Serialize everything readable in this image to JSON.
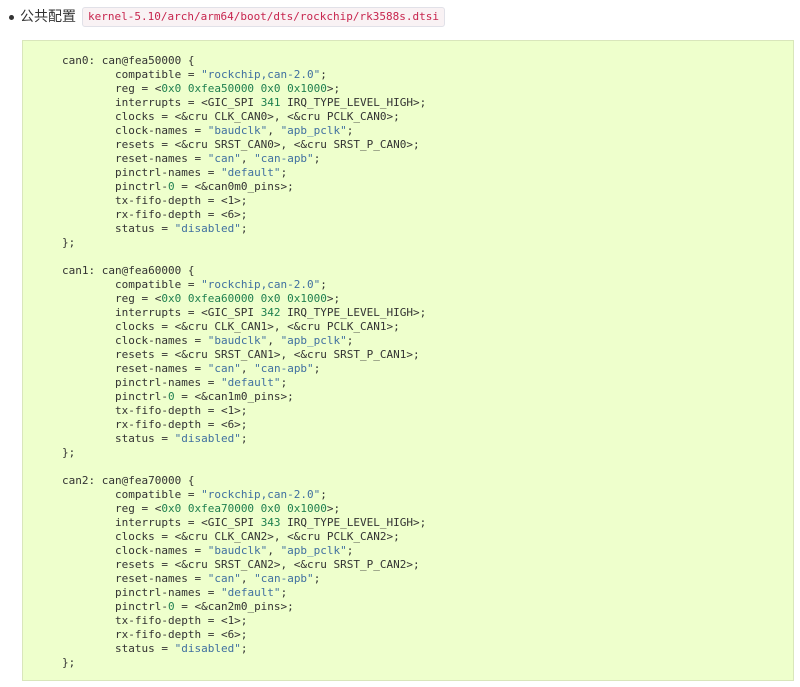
{
  "header": {
    "label": "公共配置",
    "path": "kernel-5.10/arch/arm64/boot/dts/rockchip/rk3588s.dtsi"
  },
  "code": {
    "lines": [
      [
        {
          "t": "can0: can@fea50000 {"
        }
      ],
      [
        {
          "t": "        compatible = "
        },
        {
          "t": "\"rockchip,can-2.0\"",
          "c": "str"
        },
        {
          "t": ";"
        }
      ],
      [
        {
          "t": "        reg = <"
        },
        {
          "t": "0x0 0xfea50000 0x0 0x1000",
          "c": "num"
        },
        {
          "t": ">;"
        }
      ],
      [
        {
          "t": "        interrupts = <GIC_SPI "
        },
        {
          "t": "341",
          "c": "num"
        },
        {
          "t": " IRQ_TYPE_LEVEL_HIGH>;"
        }
      ],
      [
        {
          "t": "        clocks = <&cru CLK_CAN0>, <&cru PCLK_CAN0>;"
        }
      ],
      [
        {
          "t": "        clock-names = "
        },
        {
          "t": "\"baudclk\"",
          "c": "str"
        },
        {
          "t": ", "
        },
        {
          "t": "\"apb_pclk\"",
          "c": "str"
        },
        {
          "t": ";"
        }
      ],
      [
        {
          "t": "        resets = <&cru SRST_CAN0>, <&cru SRST_P_CAN0>;"
        }
      ],
      [
        {
          "t": "        reset-names = "
        },
        {
          "t": "\"can\"",
          "c": "str"
        },
        {
          "t": ", "
        },
        {
          "t": "\"can-apb\"",
          "c": "str"
        },
        {
          "t": ";"
        }
      ],
      [
        {
          "t": "        pinctrl-names = "
        },
        {
          "t": "\"default\"",
          "c": "str"
        },
        {
          "t": ";"
        }
      ],
      [
        {
          "t": "        pinctrl-"
        },
        {
          "t": "0",
          "c": "num"
        },
        {
          "t": " = <&can0m0_pins>;"
        }
      ],
      [
        {
          "t": "        tx-fifo-depth = <1>;"
        }
      ],
      [
        {
          "t": "        rx-fifo-depth = <6>;"
        }
      ],
      [
        {
          "t": "        status = "
        },
        {
          "t": "\"disabled\"",
          "c": "str"
        },
        {
          "t": ";"
        }
      ],
      [
        {
          "t": "};"
        }
      ],
      [
        {
          "t": ""
        }
      ],
      [
        {
          "t": "can1: can@fea60000 {"
        }
      ],
      [
        {
          "t": "        compatible = "
        },
        {
          "t": "\"rockchip,can-2.0\"",
          "c": "str"
        },
        {
          "t": ";"
        }
      ],
      [
        {
          "t": "        reg = <"
        },
        {
          "t": "0x0 0xfea60000 0x0 0x1000",
          "c": "num"
        },
        {
          "t": ">;"
        }
      ],
      [
        {
          "t": "        interrupts = <GIC_SPI "
        },
        {
          "t": "342",
          "c": "num"
        },
        {
          "t": " IRQ_TYPE_LEVEL_HIGH>;"
        }
      ],
      [
        {
          "t": "        clocks = <&cru CLK_CAN1>, <&cru PCLK_CAN1>;"
        }
      ],
      [
        {
          "t": "        clock-names = "
        },
        {
          "t": "\"baudclk\"",
          "c": "str"
        },
        {
          "t": ", "
        },
        {
          "t": "\"apb_pclk\"",
          "c": "str"
        },
        {
          "t": ";"
        }
      ],
      [
        {
          "t": "        resets = <&cru SRST_CAN1>, <&cru SRST_P_CAN1>;"
        }
      ],
      [
        {
          "t": "        reset-names = "
        },
        {
          "t": "\"can\"",
          "c": "str"
        },
        {
          "t": ", "
        },
        {
          "t": "\"can-apb\"",
          "c": "str"
        },
        {
          "t": ";"
        }
      ],
      [
        {
          "t": "        pinctrl-names = "
        },
        {
          "t": "\"default\"",
          "c": "str"
        },
        {
          "t": ";"
        }
      ],
      [
        {
          "t": "        pinctrl-"
        },
        {
          "t": "0",
          "c": "num"
        },
        {
          "t": " = <&can1m0_pins>;"
        }
      ],
      [
        {
          "t": "        tx-fifo-depth = <1>;"
        }
      ],
      [
        {
          "t": "        rx-fifo-depth = <6>;"
        }
      ],
      [
        {
          "t": "        status = "
        },
        {
          "t": "\"disabled\"",
          "c": "str"
        },
        {
          "t": ";"
        }
      ],
      [
        {
          "t": "};"
        }
      ],
      [
        {
          "t": ""
        }
      ],
      [
        {
          "t": "can2: can@fea70000 {"
        }
      ],
      [
        {
          "t": "        compatible = "
        },
        {
          "t": "\"rockchip,can-2.0\"",
          "c": "str"
        },
        {
          "t": ";"
        }
      ],
      [
        {
          "t": "        reg = <"
        },
        {
          "t": "0x0 0xfea70000 0x0 0x1000",
          "c": "num"
        },
        {
          "t": ">;"
        }
      ],
      [
        {
          "t": "        interrupts = <GIC_SPI "
        },
        {
          "t": "343",
          "c": "num"
        },
        {
          "t": " IRQ_TYPE_LEVEL_HIGH>;"
        }
      ],
      [
        {
          "t": "        clocks = <&cru CLK_CAN2>, <&cru PCLK_CAN2>;"
        }
      ],
      [
        {
          "t": "        clock-names = "
        },
        {
          "t": "\"baudclk\"",
          "c": "str"
        },
        {
          "t": ", "
        },
        {
          "t": "\"apb_pclk\"",
          "c": "str"
        },
        {
          "t": ";"
        }
      ],
      [
        {
          "t": "        resets = <&cru SRST_CAN2>, <&cru SRST_P_CAN2>;"
        }
      ],
      [
        {
          "t": "        reset-names = "
        },
        {
          "t": "\"can\"",
          "c": "str"
        },
        {
          "t": ", "
        },
        {
          "t": "\"can-apb\"",
          "c": "str"
        },
        {
          "t": ";"
        }
      ],
      [
        {
          "t": "        pinctrl-names = "
        },
        {
          "t": "\"default\"",
          "c": "str"
        },
        {
          "t": ";"
        }
      ],
      [
        {
          "t": "        pinctrl-"
        },
        {
          "t": "0",
          "c": "num"
        },
        {
          "t": " = <&can2m0_pins>;"
        }
      ],
      [
        {
          "t": "        tx-fifo-depth = <1>;"
        }
      ],
      [
        {
          "t": "        rx-fifo-depth = <6>;"
        }
      ],
      [
        {
          "t": "        status = "
        },
        {
          "t": "\"disabled\"",
          "c": "str"
        },
        {
          "t": ";"
        }
      ],
      [
        {
          "t": "};"
        }
      ]
    ]
  },
  "colors": {
    "code_background": "#eeffcc",
    "string": "#4070a0",
    "number": "#208050",
    "path_text": "#c7254e"
  }
}
